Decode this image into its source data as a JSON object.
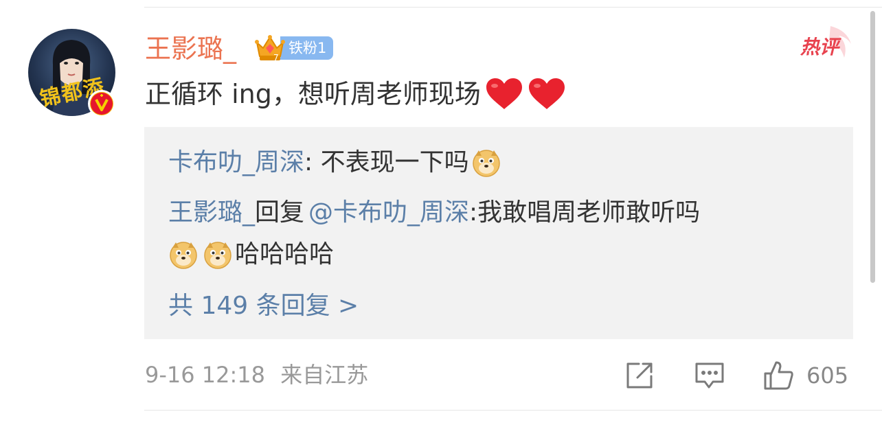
{
  "comment": {
    "username": "王影璐_",
    "fan_badge": "铁粉1",
    "crown_level": "7",
    "hot_tag": "热评",
    "text": "正循环 ing，想听周老师现场"
  },
  "avatar": {
    "decor_text": "锦都添"
  },
  "replies": {
    "line1": {
      "user": "卡布叻_周深",
      "sep": ": ",
      "text": "不表现一下吗"
    },
    "line2": {
      "user": "王影璐_",
      "verb": "回复",
      "mention": "@卡布叻_周深",
      "text": ":我敢唱周老师敢听吗"
    },
    "line3": {
      "text": "哈哈哈哈"
    },
    "more": "共 149 条回复 >"
  },
  "meta": {
    "timestamp": "9-16 12:18",
    "location": "来自江苏"
  },
  "actions": {
    "like_count": "605"
  },
  "colors": {
    "username": "#eb7350",
    "link": "#5b7fa8",
    "reply_bg": "#f2f2f2",
    "hot_tag": "#e8434f",
    "fan_badge": "#88b8f0",
    "heart": "#e8222e",
    "meta_text": "#999999"
  }
}
